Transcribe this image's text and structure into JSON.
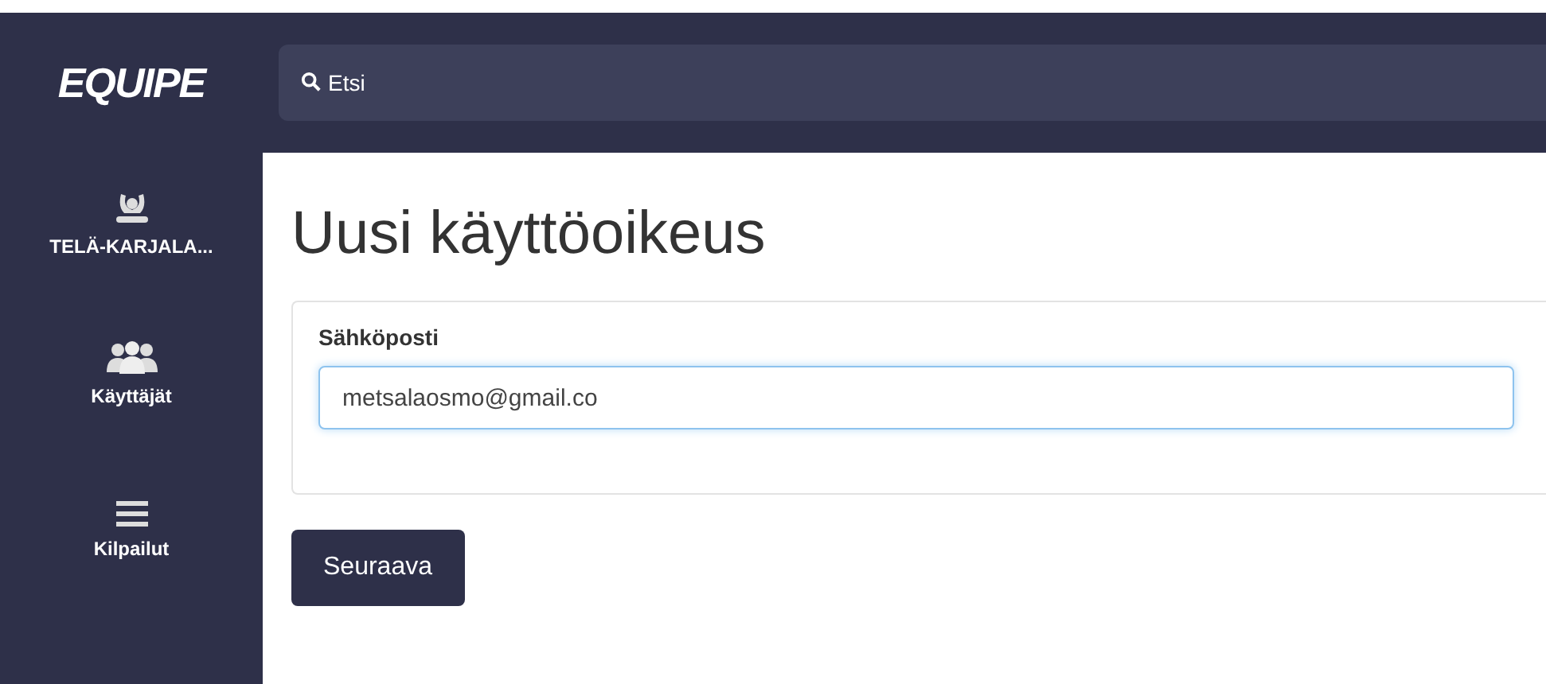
{
  "header": {
    "logo": "EQUIPE",
    "search": {
      "placeholder": "Etsi"
    }
  },
  "sidebar": {
    "items": [
      {
        "kind": "organization",
        "label": "TELÄ-KARJALA..."
      },
      {
        "kind": "users",
        "label": "Käyttäjät"
      },
      {
        "kind": "list",
        "label": "Kilpailut"
      }
    ]
  },
  "page": {
    "title": "Uusi käyttöoikeus",
    "form": {
      "label": "Sähköposti",
      "value": "metsalaosmo@gmail.co"
    },
    "button": "Seuraava"
  }
}
